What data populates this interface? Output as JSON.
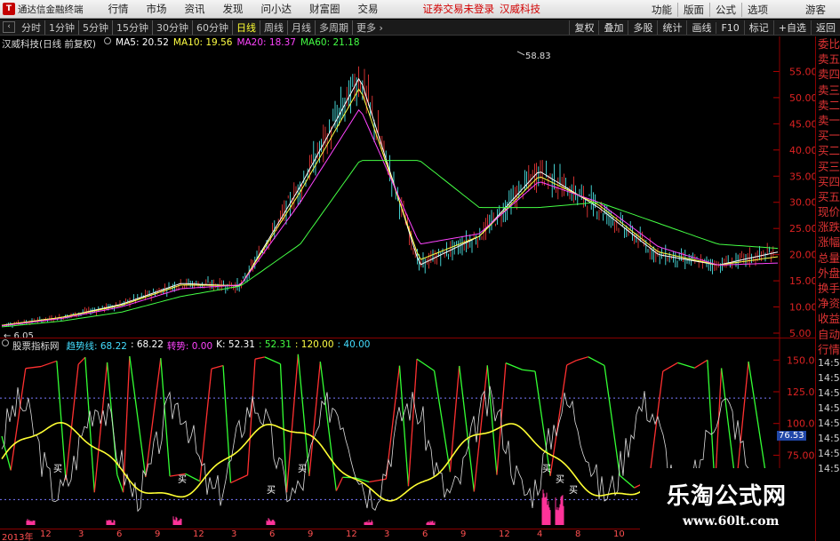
{
  "menubar": {
    "app_title": "通达信金融终端",
    "items": [
      "行情",
      "市场",
      "资讯",
      "发现",
      "问小达",
      "财富圈",
      "交易"
    ],
    "warning": "证券交易未登录",
    "stock_name": "汉威科技",
    "right_items": [
      "功能",
      "版面",
      "公式",
      "选项"
    ],
    "guest": "游客"
  },
  "toolbar": {
    "periods": [
      "分时",
      "1分钟",
      "5分钟",
      "15分钟",
      "30分钟",
      "60分钟",
      "日线",
      "周线",
      "月线",
      "多周期",
      "更多"
    ],
    "active_period": "日线",
    "more_arrow": "›",
    "right_items": [
      "复权",
      "叠加",
      "多股",
      "统计",
      "画线",
      "F10",
      "标记",
      "+自选",
      "返回"
    ]
  },
  "price_pane": {
    "title": "汉威科技(日线 前复权)",
    "ma": [
      {
        "label": "MA5: 20.52",
        "color": "#ffffff"
      },
      {
        "label": "MA10: 19.56",
        "color": "#ffff44"
      },
      {
        "label": "MA20: 18.37",
        "color": "#ff44ff"
      },
      {
        "label": "MA60: 21.18",
        "color": "#44ff44"
      }
    ],
    "high_label": "58.83",
    "low_label": "6.05",
    "y_ticks": [
      "55.00",
      "50.00",
      "45.00",
      "40.00",
      "35.00",
      "30.00",
      "25.00",
      "20.00",
      "15.00",
      "10.00",
      "5.00"
    ]
  },
  "indicator_pane": {
    "title": "股票指标网",
    "legend": [
      {
        "label": "趋势线: 68.22",
        "color": "#44ddff"
      },
      {
        "label": ": 68.22",
        "color": "#ffffff"
      },
      {
        "label": "转势: 0.00",
        "color": "#ff44ff"
      },
      {
        "label": "K: 52.31",
        "color": "#ffffff"
      },
      {
        "label": ": 52.31",
        "color": "#44ff44"
      },
      {
        "label": ": 120.00",
        "color": "#ffff44"
      },
      {
        "label": ": 40.00",
        "color": "#44ddff"
      }
    ],
    "y_ticks": [
      "150.0",
      "125.0",
      "100.0",
      "75.00"
    ],
    "current_value": "76.53",
    "buy_labels": [
      "买",
      "买",
      "买",
      "买",
      "买",
      "买",
      "买"
    ]
  },
  "date_axis": [
    "2013年",
    "12",
    "3",
    "6",
    "9",
    "12",
    "3",
    "6",
    "9",
    "12",
    "3",
    "6",
    "9",
    "12",
    "4",
    "8",
    "10",
    "11"
  ],
  "side_panel": {
    "items": [
      "委比",
      "卖五",
      "卖四",
      "卖三",
      "卖二",
      "卖一",
      "买一",
      "买二",
      "买三",
      "买四",
      "买五",
      "现价",
      "涨跌",
      "涨幅",
      "总量",
      "外盘",
      "换手",
      "净资",
      "收益",
      "自动",
      "行情"
    ],
    "times": [
      "14:50",
      "14:50",
      "14:50",
      "14:50",
      "14:50",
      "14:50",
      "14:50",
      "14:50"
    ]
  },
  "watermark": {
    "title": "乐淘公式网",
    "url": "www.60lt.com"
  },
  "chart_data": {
    "type": "line",
    "title": "汉威科技(日线 前复权)",
    "ylim": [
      5,
      60
    ],
    "x": [
      "2013-12",
      "2014-03",
      "2014-06",
      "2014-09",
      "2014-12",
      "2015-03",
      "2015-06",
      "2015-09",
      "2015-12",
      "2016-03",
      "2016-06",
      "2016-09",
      "2016-12",
      "2017-04"
    ],
    "series": [
      {
        "name": "MA5",
        "values": [
          6.5,
          8.0,
          10.5,
          14.5,
          14.0,
          33.0,
          54.0,
          18.0,
          23.5,
          36.0,
          29.0,
          20.0,
          18.0,
          20.5
        ]
      },
      {
        "name": "MA10",
        "values": [
          6.5,
          8.0,
          10.3,
          14.2,
          14.1,
          32.0,
          52.0,
          19.0,
          23.5,
          35.0,
          29.5,
          20.5,
          18.0,
          19.6
        ]
      },
      {
        "name": "MA20",
        "values": [
          6.4,
          7.8,
          10.0,
          13.5,
          14.2,
          30.0,
          48.0,
          22.0,
          24.0,
          34.0,
          30.0,
          21.5,
          18.0,
          18.4
        ]
      },
      {
        "name": "MA60",
        "values": [
          6.2,
          7.3,
          9.0,
          12.0,
          14.0,
          22.0,
          38.0,
          38.0,
          29.0,
          29.0,
          30.0,
          26.0,
          22.0,
          21.2
        ]
      }
    ],
    "annotations": [
      {
        "text": "58.83",
        "kind": "high"
      },
      {
        "text": "6.05",
        "kind": "low"
      }
    ]
  }
}
